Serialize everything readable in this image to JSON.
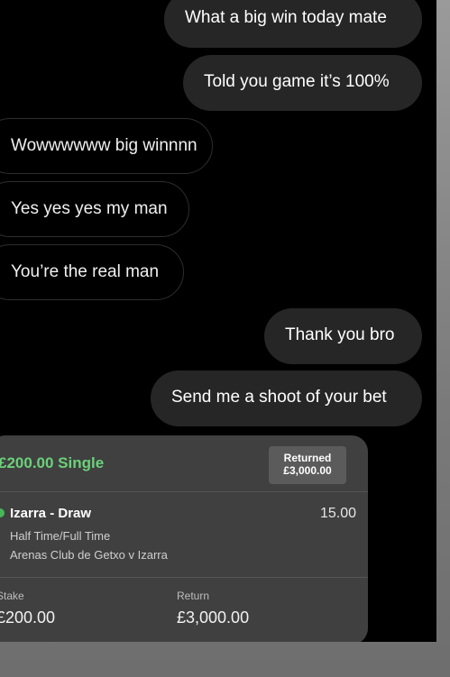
{
  "messages": [
    {
      "text": "What a big win today mate",
      "side": "out"
    },
    {
      "text": "Told you game it’s 100%",
      "side": "out"
    },
    {
      "text": "Wowwwwww big winnnn",
      "side": "in"
    },
    {
      "text": "Yes yes yes my man",
      "side": "in"
    },
    {
      "text": "You’re the real man",
      "side": "in"
    },
    {
      "text": "Thank you bro",
      "side": "out"
    },
    {
      "text": "Send me a shoot of your bet",
      "side": "out"
    }
  ],
  "bet": {
    "title": "£200.00 Single",
    "returned_label": "Returned",
    "returned_value": "£3,000.00",
    "selection": "Izarra - Draw",
    "odds": "15.00",
    "market": "Half Time/Full Time",
    "event": "Arenas Club de Getxo v Izarra",
    "stake_label": "Stake",
    "stake_value": "£200.00",
    "return_label": "Return",
    "return_value": "£3,000.00",
    "accent": "#6bd17a"
  }
}
